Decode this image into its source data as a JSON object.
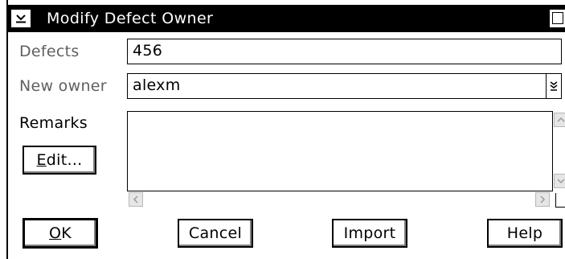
{
  "window": {
    "title": "Modify Defect Owner",
    "system_menu_icon": "chevron-down-icon",
    "maximize_icon": "maximize-icon"
  },
  "form": {
    "defects_label": "Defects",
    "defects_value": "456",
    "new_owner_label": "New owner",
    "new_owner_value": "alexm",
    "new_owner_dropdown_icon": "dropdown-arrow-icon",
    "remarks_label": "Remarks",
    "remarks_value": ""
  },
  "buttons": {
    "edit": {
      "mnemonic": "E",
      "rest": "dit..."
    },
    "ok": {
      "mnemonic": "O",
      "rest": "K"
    },
    "cancel": "Cancel",
    "import": "Import",
    "help": "Help"
  }
}
